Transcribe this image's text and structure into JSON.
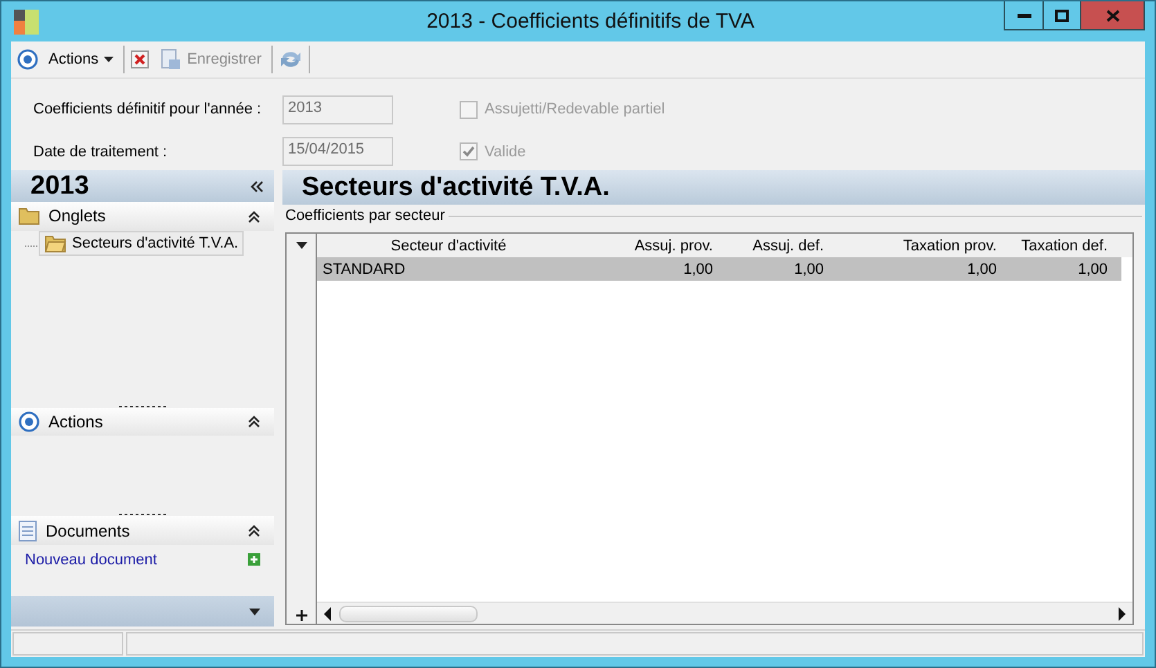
{
  "window": {
    "title": "2013 -  Coefficients définitifs de TVA"
  },
  "toolbar": {
    "actions_menu": "Actions",
    "save": "Enregistrer"
  },
  "form": {
    "year_label": "Coefficients définitif pour l'année :",
    "year_value": "2013",
    "date_label": "Date de traitement :",
    "date_value": "15/04/2015",
    "checks": [
      {
        "label": "Assujetti/Redevable partiel",
        "checked": false,
        "disabled": true
      },
      {
        "label": "Valide",
        "checked": true,
        "disabled": true
      }
    ]
  },
  "sidebar": {
    "title": "2013",
    "sections": [
      {
        "kind": "tree",
        "title": "Onglets",
        "items": [
          {
            "label": "Secteurs d'activité T.V.A.",
            "selected": true
          }
        ]
      },
      {
        "kind": "actions",
        "title": "Actions"
      },
      {
        "kind": "documents",
        "title": "Documents",
        "link": "Nouveau document"
      }
    ]
  },
  "content": {
    "title": "Secteurs d'activité T.V.A.",
    "group": "Coefficients par secteur",
    "table": {
      "columns": [
        "Secteur d'activité",
        "Assuj. prov.",
        "Assuj. def.",
        "Taxation prov.",
        "Taxation def."
      ],
      "rows": [
        {
          "cells": [
            "STANDARD",
            "1,00",
            "1,00",
            "1,00",
            "1,00"
          ],
          "selected": true
        }
      ]
    }
  }
}
